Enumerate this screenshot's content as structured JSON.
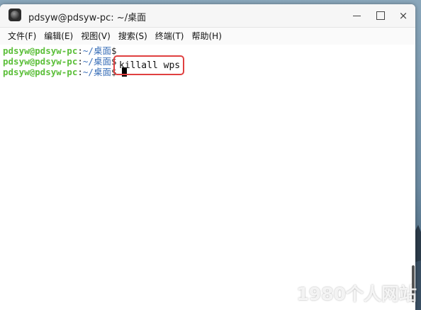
{
  "window": {
    "title": "pdsyw@pdsyw-pc: ~/桌面",
    "icon": "terminal-app-icon",
    "controls": {
      "minimize": "minimize-icon",
      "maximize": "maximize-icon",
      "close": "×"
    }
  },
  "menubar": {
    "items": [
      {
        "label": "文件(F)"
      },
      {
        "label": "编辑(E)"
      },
      {
        "label": "视图(V)"
      },
      {
        "label": "搜索(S)"
      },
      {
        "label": "终端(T)"
      },
      {
        "label": "帮助(H)"
      }
    ]
  },
  "terminal": {
    "lines": [
      {
        "user": "pdsyw@pdsyw-pc",
        "colon": ":",
        "path": "~/桌面",
        "dollar": "$",
        "command": ""
      },
      {
        "user": "pdsyw@pdsyw-pc",
        "colon": ":",
        "path": "~/桌面",
        "dollar": "$",
        "command": "killall wps"
      },
      {
        "user": "pdsyw@pdsyw-pc",
        "colon": ":",
        "path": "~/桌面",
        "dollar": "$",
        "command": ""
      }
    ],
    "highlight_color": "#e04040"
  },
  "watermark": {
    "text": "1980个人网站"
  },
  "colors": {
    "prompt_user": "#5cbf3a",
    "prompt_path": "#3a6fb8"
  }
}
